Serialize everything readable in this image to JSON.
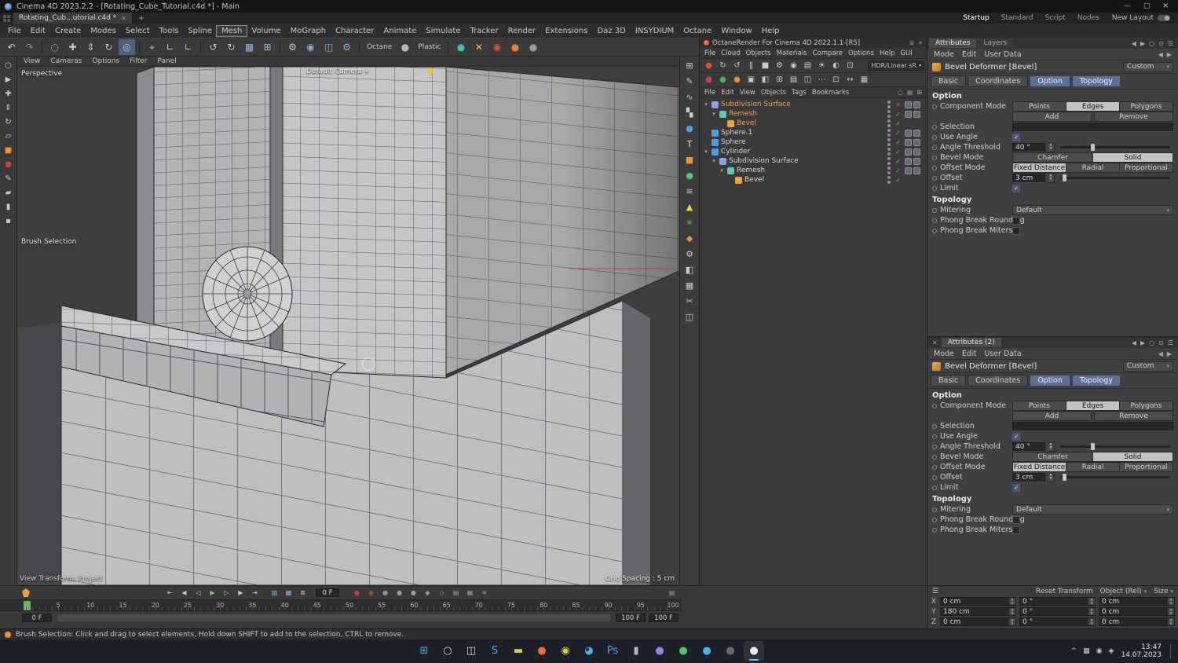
{
  "window": {
    "title": "Cinema 4D 2023.2.2 - [Rotating_Cube_Tutorial.c4d *] - Main",
    "controls": {
      "minimize": "—",
      "maximize": "▢",
      "close": "✕"
    }
  },
  "tabbar": {
    "document_tab": "Rotating_Cub...utorial.c4d *",
    "close_glyph": "✕",
    "add_tab": "+",
    "layouts": [
      "Startup",
      "Standard",
      "Script",
      "Nodes"
    ],
    "active_layout": "Startup",
    "new_layout_label": "New Layout"
  },
  "menubar": {
    "items": [
      "File",
      "Edit",
      "Create",
      "Modes",
      "Select",
      "Tools",
      "Spline",
      "Mesh",
      "Volume",
      "MoGraph",
      "Character",
      "Animate",
      "Simulate",
      "Tracker",
      "Render",
      "Extensions",
      "Daz 3D",
      "INSYDIUM",
      "Octane",
      "Window",
      "Help"
    ],
    "highlighted": "Mesh"
  },
  "toolbar": {
    "icons": [
      {
        "name": "undo-icon",
        "glyph": "↶"
      },
      {
        "name": "redo-icon",
        "glyph": "↷",
        "color": "#8f8f8f"
      },
      {
        "sep": true
      },
      {
        "name": "live-selection-icon",
        "glyph": "◌"
      },
      {
        "name": "move-tool-icon",
        "glyph": "✚"
      },
      {
        "name": "scale-tool-icon",
        "glyph": "⇕"
      },
      {
        "name": "rotate-tool-icon",
        "glyph": "↻"
      },
      {
        "name": "last-tool-icon",
        "glyph": "◎",
        "color": "#9fc4e8",
        "active": true
      },
      {
        "sep": true
      },
      {
        "name": "coordinate-system-icon",
        "glyph": "⌖"
      },
      {
        "name": "workplane-x-icon",
        "glyph": "∟"
      },
      {
        "name": "workplane-y-icon",
        "glyph": "∟",
        "color": "#9fc4e8"
      },
      {
        "sep": true
      },
      {
        "name": "rotate-left-icon",
        "glyph": "↺"
      },
      {
        "name": "rotate-right-icon",
        "glyph": "↻"
      },
      {
        "name": "snap-grid-icon",
        "glyph": "▦",
        "color": "#8fb6e0"
      },
      {
        "name": "quantize-icon",
        "glyph": "⊞",
        "color": "#8fb6e0"
      },
      {
        "sep": true
      },
      {
        "name": "modeling-settings-icon",
        "glyph": "⚙"
      },
      {
        "name": "render-view-icon",
        "glyph": "◉",
        "color": "#7fb2d8"
      },
      {
        "name": "render-picture-viewer-icon",
        "glyph": "◫",
        "color": "#7fb2d8"
      },
      {
        "name": "render-settings-icon",
        "glyph": "⚙",
        "color": "#7fb2d8"
      },
      {
        "sep": true
      },
      {
        "name": "octane-engine-label",
        "label": "Octane"
      },
      {
        "name": "material-preview-sphere-icon",
        "glyph": "●",
        "color": "#b8b8b8"
      },
      {
        "name": "material-preview-label",
        "label": "Plastic"
      },
      {
        "sep": true
      },
      {
        "name": "asset-browser-icon",
        "glyph": "●",
        "color": "#3fbfb0"
      },
      {
        "name": "xparticles-icon",
        "glyph": "✕",
        "color": "#e8c83d"
      },
      {
        "name": "octane-logo-icon",
        "glyph": "◉",
        "color": "#e8502e"
      },
      {
        "name": "octane-render-icon",
        "glyph": "●",
        "color": "#e8822e"
      },
      {
        "name": "plugin-icon",
        "glyph": "●",
        "color": "#9a9a9a"
      }
    ]
  },
  "left_strip": [
    {
      "name": "zoom-icon",
      "glyph": "○"
    },
    {
      "name": "select-arrow-icon",
      "glyph": "▶"
    },
    {
      "name": "move-icon",
      "glyph": "✚"
    },
    {
      "name": "scale-icon",
      "glyph": "⇕"
    },
    {
      "name": "rotate-icon",
      "glyph": "↻"
    },
    {
      "name": "workplane-icon",
      "glyph": "▱"
    },
    {
      "name": "color-swatch-icon",
      "glyph": "■",
      "color": "#e8952e"
    },
    {
      "name": "color-dot-icon",
      "glyph": "●",
      "color": "#cc4430"
    },
    {
      "name": "pen-icon",
      "glyph": "✎"
    },
    {
      "name": "brush-icon",
      "glyph": "▰"
    },
    {
      "name": "knife-icon",
      "glyph": "▮"
    },
    {
      "name": "misc-tool-icon",
      "glyph": "▪"
    }
  ],
  "right_strip": [
    {
      "name": "array-icon",
      "glyph": "⊞"
    },
    {
      "name": "spline-pen-icon",
      "glyph": "✎"
    },
    {
      "name": "spline-icon",
      "glyph": "∿"
    },
    {
      "name": "magnet-icon",
      "glyph": "▚"
    },
    {
      "name": "material-ball-icon",
      "glyph": "●",
      "color": "#4f9fe8"
    },
    {
      "name": "text-tool-icon",
      "glyph": "T",
      "color": "#e0e0e0"
    },
    {
      "name": "cube-icon",
      "glyph": "■",
      "color": "#e8952e"
    },
    {
      "name": "sphere-icon",
      "glyph": "●",
      "color": "#4dc66f"
    },
    {
      "name": "deformer-icon",
      "glyph": "≋"
    },
    {
      "name": "pyramid-icon",
      "glyph": "▲",
      "color": "#e8d44d"
    },
    {
      "name": "plant-icon",
      "glyph": "✳",
      "color": "#4dc66f"
    },
    {
      "name": "platonic-icon",
      "glyph": "◆",
      "color": "#e8952e"
    },
    {
      "name": "modifier-gear-icon",
      "glyph": "⚙"
    },
    {
      "name": "boole-icon",
      "glyph": "◧"
    },
    {
      "name": "grid-icon",
      "glyph": "▦"
    },
    {
      "name": "knife-tool-icon",
      "glyph": "✂"
    },
    {
      "name": "symmetry-icon",
      "glyph": "◫"
    }
  ],
  "viewport": {
    "menu": [
      "View",
      "Cameras",
      "Options",
      "Filter",
      "Panel"
    ],
    "view_label": "Perspective",
    "camera_label": "Default Camera",
    "tool_label": "Brush Selection",
    "transform_label": "View Transform: Project",
    "grid_label": "Grid Spacing : 5 cm"
  },
  "octane": {
    "title": "OctaneRender For Cinema 4D 2022.1.1-[R5]",
    "menu": [
      "File",
      "Cloud",
      "Objects",
      "Materials",
      "Compare",
      "Options",
      "Help",
      "GUI"
    ],
    "colorspace": "HDR/Linear sR",
    "toolbar1": [
      {
        "name": "octane-logo-icon",
        "glyph": "●",
        "color": "#e8502e"
      },
      {
        "name": "refresh-render-icon",
        "glyph": "↻"
      },
      {
        "name": "restart-icon",
        "glyph": "↺"
      },
      {
        "name": "pause-icon",
        "glyph": "‖"
      },
      {
        "name": "stop-icon",
        "glyph": "■"
      },
      {
        "name": "render-settings-icon",
        "glyph": "⚙"
      },
      {
        "name": "focus-picker-icon",
        "glyph": "◉"
      },
      {
        "name": "layers-icon",
        "glyph": "▤"
      },
      {
        "name": "sun-icon",
        "glyph": "☀"
      },
      {
        "name": "exposure-icon",
        "glyph": "◐"
      },
      {
        "name": "region-render-icon",
        "glyph": "⊡"
      }
    ],
    "toolbar2": [
      {
        "name": "material-red-icon",
        "glyph": "●",
        "color": "#d04040"
      },
      {
        "name": "material-green-icon",
        "glyph": "●",
        "color": "#50b050"
      },
      {
        "name": "material-orange-icon",
        "glyph": "●",
        "color": "#e09030"
      },
      {
        "name": "texture-icon",
        "glyph": "▣"
      },
      {
        "name": "split-view-icon",
        "glyph": "◧"
      },
      {
        "name": "grid-view-icon",
        "glyph": "⊞"
      },
      {
        "name": "list-view-icon",
        "glyph": "▤"
      },
      {
        "name": "panels-icon",
        "glyph": "◫"
      },
      {
        "name": "more-icon",
        "glyph": "⋯"
      },
      {
        "name": "lock-resolution-icon",
        "glyph": "⊡"
      },
      {
        "name": "fit-view-icon",
        "glyph": "↔"
      },
      {
        "name": "aspect-icon",
        "glyph": "▦"
      }
    ]
  },
  "object_manager": {
    "menu": [
      "File",
      "Edit",
      "View",
      "Objects",
      "Tags",
      "Bookmarks"
    ],
    "right_icons": [
      {
        "name": "om-search-icon",
        "glyph": "○"
      },
      {
        "name": "om-filter-icon",
        "glyph": "▤"
      },
      {
        "name": "om-path-icon",
        "glyph": "⊞"
      }
    ],
    "items": [
      {
        "label": "Subdivision Surface",
        "indent": 0,
        "expand": true,
        "selected": true,
        "state": "x",
        "icon": "#8f9fe0",
        "tags": 2
      },
      {
        "label": "Remesh",
        "indent": 1,
        "expand": true,
        "selected": true,
        "state": "check",
        "icon": "#5fc9b4",
        "tags": 2
      },
      {
        "label": "Bevel",
        "indent": 2,
        "expand": false,
        "selected": true,
        "state": "check",
        "icon": "#e8a33d",
        "tags": 0
      },
      {
        "label": "Sphere.1",
        "indent": 0,
        "expand": false,
        "selected": false,
        "state": "check",
        "icon": "#4f9fe0",
        "tags": 2
      },
      {
        "label": "Sphere",
        "indent": 0,
        "expand": false,
        "selected": false,
        "state": "check",
        "icon": "#4f9fe0",
        "tags": 2
      },
      {
        "label": "Cylinder",
        "indent": 0,
        "expand": true,
        "selected": false,
        "state": "check",
        "icon": "#4f9fe0",
        "tags": 2
      },
      {
        "label": "Subdivision Surface",
        "indent": 1,
        "expand": true,
        "selected": false,
        "state": "check",
        "icon": "#8f9fe0",
        "tags": 2
      },
      {
        "label": "Remesh",
        "indent": 2,
        "expand": true,
        "selected": false,
        "state": "check",
        "icon": "#5fc9b4",
        "tags": 2
      },
      {
        "label": "Bevel",
        "indent": 3,
        "expand": false,
        "selected": false,
        "state": "check",
        "icon": "#e8a33d",
        "tags": 0
      }
    ]
  },
  "attributes_panel": {
    "tab_attributes": "Attributes",
    "tab_layers": "Layers",
    "panel2_title": "Attributes (2)",
    "mode_items": [
      "Mode",
      "Edit",
      "User Data"
    ],
    "object_title": "Bevel Deformer [Bevel]",
    "preset": "Custom",
    "tabs": [
      "Basic",
      "Coordinates",
      "Option",
      "Topology"
    ],
    "section_option": "Option",
    "component_mode_label": "Component Mode",
    "component_modes": [
      "Points",
      "Edges",
      "Polygons"
    ],
    "component_mode_selected": "Edges",
    "add_label": "Add",
    "remove_label": "Remove",
    "selection_label": "Selection",
    "use_angle_label": "Use Angle",
    "use_angle_checked": true,
    "angle_threshold_label": "Angle Threshold",
    "angle_threshold_value": "40 °",
    "bevel_mode_label": "Bevel Mode",
    "bevel_modes": [
      "Chamfer",
      "Solid"
    ],
    "bevel_mode_selected": "Solid",
    "offset_mode_label": "Offset Mode",
    "offset_modes": [
      "Fixed Distance",
      "Radial",
      "Proportional"
    ],
    "offset_mode_selected": "Fixed Distance",
    "offset_label": "Offset",
    "offset_value": "3 cm",
    "limit_label": "Limit",
    "limit_checked": true,
    "section_topology": "Topology",
    "mitering_label": "Mitering",
    "mitering_value": "Default",
    "phong_rounding_label": "Phong Break Rounding",
    "phong_rounding_checked": false,
    "phong_miters_label": "Phong Break Miters",
    "phong_miters_checked": false
  },
  "coordinates": {
    "reset_label": "Reset Transform",
    "mode_label": "Object (Rel)",
    "size_label": "Size",
    "rows": [
      {
        "axis": "X",
        "position": "0 cm",
        "rotation": "0 °",
        "scale": "0 cm"
      },
      {
        "axis": "Y",
        "position": "180 cm",
        "rotation": "0 °",
        "scale": "0 cm"
      },
      {
        "axis": "Z",
        "position": "0 cm",
        "rotation": "0 °",
        "scale": "0 cm"
      }
    ]
  },
  "timeline": {
    "current_frame": "0 F",
    "range_start": "0 F",
    "range_end": "100 F",
    "range_end2": "100 F",
    "ticks": [
      "5",
      "10",
      "15",
      "20",
      "25",
      "30",
      "35",
      "40",
      "45",
      "50",
      "55",
      "60",
      "65",
      "70",
      "75",
      "80",
      "85",
      "90",
      "95",
      "100"
    ],
    "transport": [
      {
        "name": "goto-start-button",
        "glyph": "⇤"
      },
      {
        "name": "previous-key-button",
        "glyph": "◀"
      },
      {
        "name": "previous-frame-button",
        "glyph": "◁"
      },
      {
        "name": "play-button",
        "glyph": "▶",
        "color": "#7ec87e"
      },
      {
        "name": "next-frame-button",
        "glyph": "▷"
      },
      {
        "name": "next-key-button",
        "glyph": "▶"
      },
      {
        "name": "goto-end-button",
        "glyph": "⇥"
      }
    ],
    "toggles": [
      {
        "name": "point-level-animation-icon",
        "glyph": "▥",
        "color": "#8fb6e0"
      },
      {
        "name": "reduced-modification-icon",
        "glyph": "▦",
        "color": "#8fb6e0"
      },
      {
        "name": "timeline-mode-icon",
        "glyph": "≣"
      }
    ],
    "record": [
      {
        "name": "record-button",
        "glyph": "●",
        "color": "#cc3a3a"
      },
      {
        "name": "autokeying-button",
        "glyph": "◉",
        "color": "#b85050"
      },
      {
        "name": "record-position-icon",
        "glyph": "●",
        "color": "#9a9a9a"
      },
      {
        "name": "record-scale-icon",
        "glyph": "●",
        "color": "#9a9a9a"
      },
      {
        "name": "record-rotation-icon",
        "glyph": "●",
        "color": "#9a9a9a"
      },
      {
        "name": "record-parameter-icon",
        "glyph": "◆",
        "color": "#9a9a9a"
      },
      {
        "name": "record-pla-icon",
        "glyph": "◇",
        "color": "#9a9a9a"
      },
      {
        "name": "keyframe-selection-icon",
        "glyph": "▤",
        "color": "#9a9a9a"
      },
      {
        "name": "timeline-ruler-icon",
        "glyph": "▦",
        "color": "#9a9a9a"
      },
      {
        "name": "motion-system-icon",
        "glyph": "≋",
        "color": "#9a9a9a"
      }
    ]
  },
  "statusbar": {
    "text": "Brush Selection: Click and drag to select elements. Hold down SHIFT to add to the selection, CTRL to remove."
  },
  "taskbar": {
    "apps": [
      {
        "name": "start-button",
        "glyph": "⊞",
        "color": "#4fa3e8"
      },
      {
        "name": "search-button",
        "glyph": "○",
        "color": "#d8d8d8"
      },
      {
        "name": "task-view-button",
        "glyph": "◫",
        "color": "#d8d8d8"
      },
      {
        "name": "skype-icon",
        "glyph": "S",
        "color": "#45b6e8"
      },
      {
        "name": "explorer-icon",
        "glyph": "▬",
        "color": "#e8c14d"
      },
      {
        "name": "firefox-icon",
        "glyph": "●",
        "color": "#e8702e"
      },
      {
        "name": "chrome-icon",
        "glyph": "◉",
        "color": "#e8d04d"
      },
      {
        "name": "edge-icon",
        "glyph": "◕",
        "color": "#45b6e8"
      },
      {
        "name": "photoshop-icon",
        "glyph": "Ps",
        "color": "#4f9fe8"
      },
      {
        "name": "terminal-icon",
        "glyph": "▮",
        "color": "#b8b8b8"
      },
      {
        "name": "discord-icon",
        "glyph": "●",
        "color": "#8a8ae8"
      },
      {
        "name": "whatsapp-icon",
        "glyph": "●",
        "color": "#4dc66f"
      },
      {
        "name": "telegram-icon",
        "glyph": "●",
        "color": "#45b6e8"
      },
      {
        "name": "obs-icon",
        "glyph": "●",
        "color": "#6a6a6a"
      },
      {
        "name": "cinema4d-icon",
        "glyph": "●",
        "color": "#eaeaea",
        "active": true
      }
    ],
    "tray": [
      {
        "name": "hidden-icons-chevron",
        "glyph": "^"
      },
      {
        "name": "tray-app-icon",
        "glyph": "▦"
      },
      {
        "name": "network-icon",
        "glyph": "◉"
      },
      {
        "name": "volume-icon",
        "glyph": "◈"
      }
    ],
    "time": "13:47",
    "date": "14.07.2023"
  }
}
